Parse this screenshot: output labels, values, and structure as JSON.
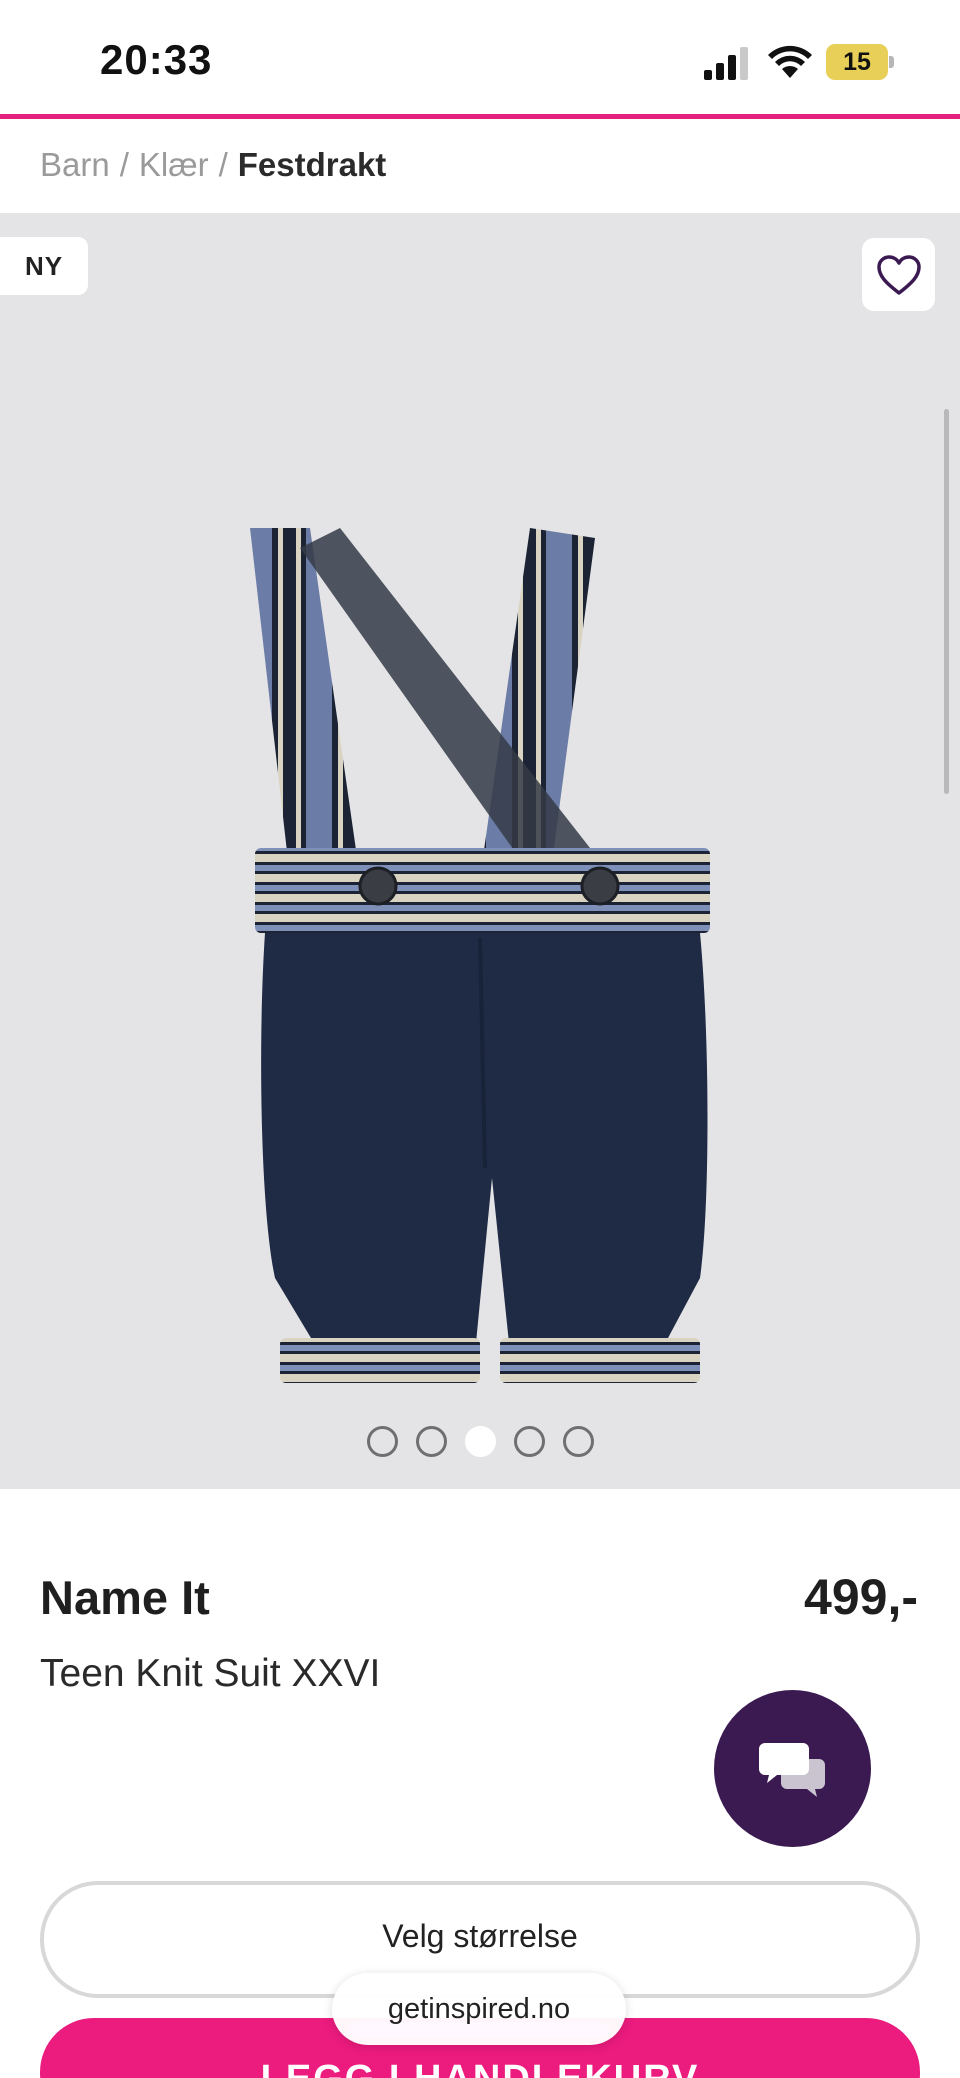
{
  "status_bar": {
    "time": "20:33",
    "battery_level": "15",
    "icons": [
      "signal-icon",
      "wifi-icon",
      "battery-icon"
    ]
  },
  "theme": {
    "accent": "#e3217e",
    "cta_color": "#ec1b7e",
    "chat_color": "#3b1a52",
    "image_background": "#e4e4e6"
  },
  "breadcrumb": {
    "items": [
      "Barn",
      "Klær"
    ],
    "current": "Festdrakt",
    "separator": "/"
  },
  "gallery": {
    "badge": "NY",
    "wishlist_icon": "heart-outline-icon",
    "image_count": 5,
    "active_image": 3
  },
  "product": {
    "brand": "Name It",
    "price": "499,-",
    "name": "Teen Knit Suit XXVI"
  },
  "chat": {
    "icon": "chat-bubbles-icon"
  },
  "actions": {
    "size_select_label": "Velg størrelse",
    "add_to_cart_label": "LEGG I HANDLEKURV"
  },
  "browser": {
    "url": "getinspired.no"
  }
}
